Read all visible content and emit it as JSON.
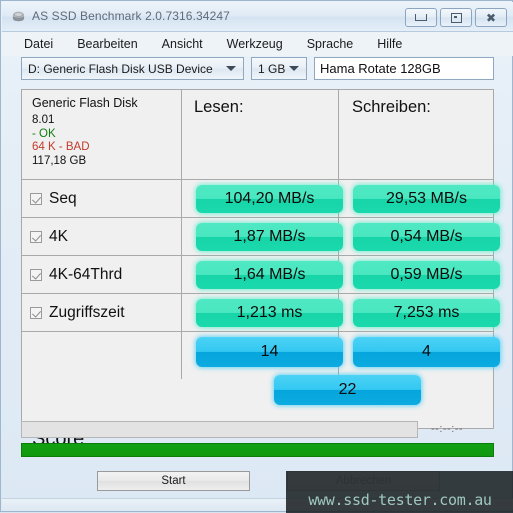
{
  "window": {
    "title": "AS SSD Benchmark 2.0.7316.34247",
    "icon": "hard-disk-icon",
    "controls": {
      "minimize": "minimize-icon",
      "restore": "restore-icon",
      "close": "close-icon"
    }
  },
  "menu": {
    "items": [
      "Datei",
      "Bearbeiten",
      "Ansicht",
      "Werkzeug",
      "Sprache",
      "Hilfe"
    ]
  },
  "toolbar": {
    "drive": "D: Generic Flash Disk USB Device",
    "size": "1 GB",
    "name_value": "Hama Rotate 128GB"
  },
  "disk_info": {
    "model": "Generic Flash Disk",
    "firmware": "8.01",
    "status": "- OK",
    "alignment": "64 K - BAD",
    "capacity": "117,18 GB"
  },
  "headers": {
    "read": "Lesen:",
    "write": "Schreiben:"
  },
  "rows": [
    {
      "label": "Seq",
      "checked": true,
      "read": "104,20 MB/s",
      "write": "29,53 MB/s"
    },
    {
      "label": "4K",
      "checked": true,
      "read": "1,87 MB/s",
      "write": "0,54 MB/s"
    },
    {
      "label": "4K-64Thrd",
      "checked": true,
      "read": "1,64 MB/s",
      "write": "0,59 MB/s"
    },
    {
      "label": "Zugriffszeit",
      "checked": true,
      "read": "1,213 ms",
      "write": "7,253 ms"
    }
  ],
  "score": {
    "label": "Score:",
    "read": "14",
    "write": "4",
    "total": "22"
  },
  "status": {
    "timer": "--:--:--",
    "progress_percent": 0
  },
  "buttons": {
    "start": "Start",
    "cancel": "Abbrechen"
  },
  "watermark": {
    "text": "www.ssd-tester.com.au"
  },
  "colors": {
    "pill_teal": "#2ee0b0",
    "pill_blue": "#12abe0",
    "status_ok": "#137b13",
    "status_bad": "#c23a2b",
    "progress_green": "#12a012"
  }
}
